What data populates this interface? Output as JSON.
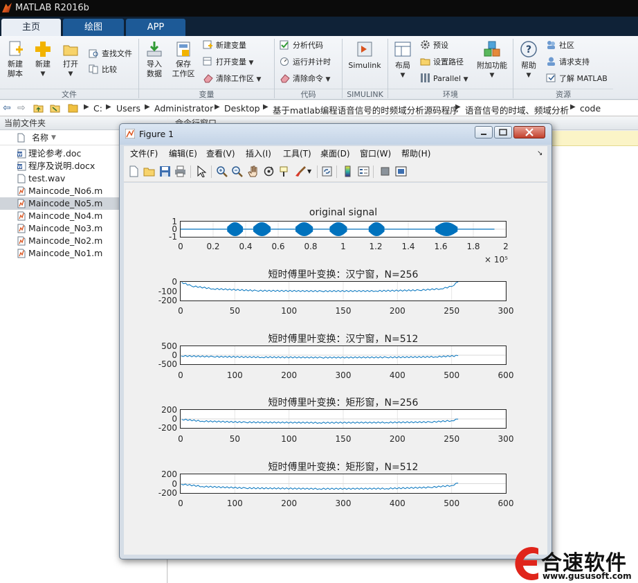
{
  "app": {
    "title": "MATLAB R2016b"
  },
  "tabs": [
    {
      "label": "主页",
      "active": true
    },
    {
      "label": "绘图",
      "active": false
    },
    {
      "label": "APP",
      "active": false
    }
  ],
  "ribbon": {
    "sections": {
      "file": "文件",
      "variable": "变量",
      "code": "代码",
      "simulink": "SIMULINK",
      "environment": "环境",
      "resources": "资源"
    },
    "buttons": {
      "new_script_1": "新建",
      "new_script_2": "脚本",
      "new": "新建",
      "open": "打开",
      "find_files": "查找文件",
      "compare": "比较",
      "import_1": "导入",
      "import_2": "数据",
      "save_ws_1": "保存",
      "save_ws_2": "工作区",
      "new_variable": "新建变量",
      "open_variable": "打开变量",
      "clear_workspace": "清除工作区",
      "analyze_code": "分析代码",
      "run_and_time": "运行并计时",
      "clear_commands": "清除命令",
      "simulink": "Simulink",
      "layout": "布局",
      "preferences": "预设",
      "set_path": "设置路径",
      "parallel": "Parallel",
      "addons": "附加功能",
      "help": "帮助",
      "community": "社区",
      "request_support": "请求支持",
      "learn_matlab": "了解 MATLAB"
    }
  },
  "path": [
    "C:",
    "Users",
    "Administrator",
    "Desktop",
    "基于matlab编程语音信号的时频域分析源码程序",
    "语音信号的时域、频域分析",
    "code"
  ],
  "current_folder": {
    "header": "当前文件夹",
    "column_name": "名称",
    "files": [
      {
        "name": "理论参考.doc",
        "type": "doc",
        "selected": false
      },
      {
        "name": "程序及说明.docx",
        "type": "doc",
        "selected": false
      },
      {
        "name": "test.wav",
        "type": "wav",
        "selected": false
      },
      {
        "name": "Maincode_No6.m",
        "type": "m",
        "selected": false
      },
      {
        "name": "Maincode_No5.m",
        "type": "m",
        "selected": true
      },
      {
        "name": "Maincode_No4.m",
        "type": "m",
        "selected": false
      },
      {
        "name": "Maincode_No3.m",
        "type": "m",
        "selected": false
      },
      {
        "name": "Maincode_No2.m",
        "type": "m",
        "selected": false
      },
      {
        "name": "Maincode_No1.m",
        "type": "m",
        "selected": false
      }
    ]
  },
  "command_window": {
    "header": "命令行窗口"
  },
  "figure": {
    "title": "Figure 1",
    "menus": [
      "文件(F)",
      "编辑(E)",
      "查看(V)",
      "插入(I)",
      "工具(T)",
      "桌面(D)",
      "窗口(W)",
      "帮助(H)"
    ]
  },
  "chart_data": [
    {
      "type": "line",
      "title": "original signal",
      "xlim": [
        0,
        2
      ],
      "x_exponent": "× 10⁵",
      "x_ticks": [
        "0",
        "0.2",
        "0.4",
        "0.6",
        "0.8",
        "1",
        "1.2",
        "1.4",
        "1.6",
        "1.8",
        "2"
      ],
      "ylim": [
        -1,
        1
      ],
      "y_ticks": [
        "1",
        "0",
        "-1"
      ],
      "bursts": [
        [
          0.29,
          0.38
        ],
        [
          0.45,
          0.55
        ],
        [
          0.71,
          0.81
        ],
        [
          0.92,
          1.02
        ],
        [
          1.16,
          1.25
        ],
        [
          1.57,
          1.7
        ]
      ],
      "color": "#0072bd"
    },
    {
      "type": "line",
      "title": "短时傅里叶变换：汉宁窗，N=256",
      "xlim": [
        0,
        300
      ],
      "x_ticks": [
        "0",
        "50",
        "100",
        "150",
        "200",
        "250",
        "300"
      ],
      "ylim": [
        -200,
        0
      ],
      "y_ticks": [
        "0",
        "-100",
        "-200"
      ],
      "curve_y": [
        -5,
        -45,
        -75,
        -95,
        -100,
        -98,
        -90,
        -75,
        -50,
        0
      ],
      "curve_x": [
        1,
        10,
        30,
        70,
        130,
        180,
        220,
        240,
        250,
        256
      ],
      "color": "#0072bd"
    },
    {
      "type": "line",
      "title": "短时傅里叶变换：汉宁窗，N=512",
      "xlim": [
        0,
        600
      ],
      "x_ticks": [
        "0",
        "100",
        "200",
        "300",
        "400",
        "500",
        "600"
      ],
      "ylim": [
        -500,
        500
      ],
      "y_ticks": [
        "500",
        "0",
        "-500"
      ],
      "curve_y": [
        -40,
        -80,
        -110,
        -130,
        -120,
        -90,
        -30
      ],
      "curve_x": [
        1,
        60,
        150,
        260,
        380,
        470,
        512
      ],
      "color": "#0072bd"
    },
    {
      "type": "line",
      "title": "短时傅里叶变换：矩形窗，N=256",
      "xlim": [
        0,
        300
      ],
      "x_ticks": [
        "0",
        "50",
        "100",
        "150",
        "200",
        "250",
        "300"
      ],
      "ylim": [
        -200,
        200
      ],
      "y_ticks": [
        "200",
        "0",
        "-200"
      ],
      "curve_y": [
        -10,
        -50,
        -75,
        -85,
        -80,
        -70,
        -40,
        -5
      ],
      "curve_x": [
        1,
        20,
        60,
        128,
        190,
        230,
        250,
        256
      ],
      "color": "#0072bd"
    },
    {
      "type": "line",
      "title": "短时傅里叶变换：矩形窗，N=512",
      "xlim": [
        0,
        600
      ],
      "x_ticks": [
        "0",
        "100",
        "200",
        "300",
        "400",
        "500",
        "600"
      ],
      "ylim": [
        -200,
        200
      ],
      "y_ticks": [
        "200",
        "0",
        "-200"
      ],
      "curve_y": [
        -10,
        -60,
        -95,
        -110,
        -105,
        -80,
        -40,
        10
      ],
      "curve_x": [
        1,
        40,
        120,
        256,
        380,
        460,
        500,
        512
      ],
      "color": "#0072bd"
    }
  ],
  "watermark": {
    "brand": "合速软件",
    "url": "www.gususoft.com"
  }
}
